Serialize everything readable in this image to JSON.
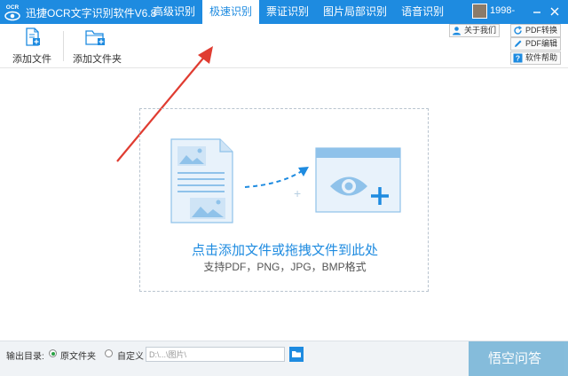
{
  "titlebar": {
    "logo_text": "OCR",
    "app_title": "迅捷OCR文字识别软件V6.8",
    "menu": [
      {
        "label": "高级识别",
        "active": false
      },
      {
        "label": "极速识别",
        "active": true
      },
      {
        "label": "票证识别",
        "active": false
      },
      {
        "label": "图片局部识别",
        "active": false
      },
      {
        "label": "语音识别",
        "active": false
      }
    ],
    "user_name": "1998-",
    "minimize_icon": "minimize-icon",
    "close_icon": "close-icon"
  },
  "toolbar": {
    "add_file_label": "添加文件",
    "add_folder_label": "添加文件夹",
    "about_label": "关于我们",
    "pdf_convert_label": "PDF转换",
    "pdf_edit_label": "PDF编辑",
    "help_label": "软件帮助"
  },
  "main": {
    "drop_title": "点击添加文件或拖拽文件到此处",
    "drop_subtitle": "支持PDF，PNG，JPG，BMP格式"
  },
  "footer": {
    "output_label": "输出目录:",
    "option_source": "原文件夹",
    "option_custom": "自定义",
    "selected": "source",
    "path_value": "D:\\...\\图片\\",
    "watermark": "悟空问答"
  },
  "colors": {
    "accent": "#1e8be0",
    "arrow": "#e03c31",
    "radio_selected": "#27a243"
  }
}
